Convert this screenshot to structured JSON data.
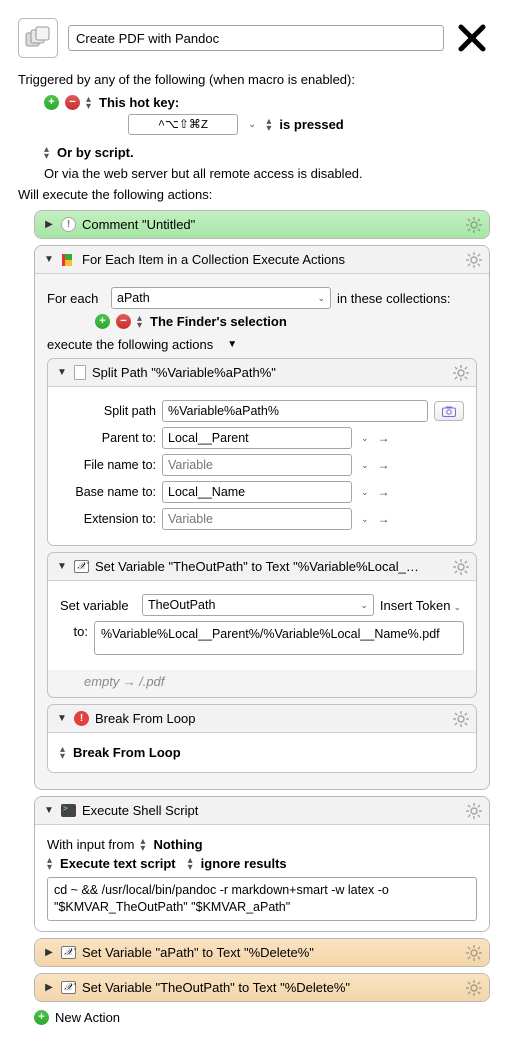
{
  "title": "Create PDF with Pandoc",
  "triggered_label": "Triggered by any of the following (when macro is enabled):",
  "hotkey": {
    "label": "This hot key:",
    "keys": "^⌥⇧⌘Z",
    "condition": "is pressed"
  },
  "script_line": "Or by script.",
  "webserver_line": "Or via the web server but all remote access is disabled.",
  "execute_label": "Will execute the following actions:",
  "comment": {
    "header": "Comment \"Untitled\""
  },
  "foreach": {
    "header": "For Each Item in a Collection Execute Actions",
    "for_each_label": "For each",
    "var_name": "aPath",
    "in_collections": "in these collections:",
    "finder_sel": "The Finder's selection",
    "execute_line": "execute the following actions"
  },
  "splitpath": {
    "header": "Split Path \"%Variable%aPath%\"",
    "label_split": "Split path",
    "val_split": "%Variable%aPath%",
    "label_parent": "Parent to:",
    "val_parent": "Local__Parent",
    "label_filename": "File name to:",
    "ph_variable": "Variable",
    "label_basename": "Base name to:",
    "val_basename": "Local__Name",
    "label_ext": "Extension to:"
  },
  "setvar1": {
    "header": "Set Variable \"TheOutPath\" to Text \"%Variable%Local_…",
    "label_set": "Set variable",
    "val_var": "TheOutPath",
    "insert_token": "Insert Token",
    "label_to": "to:",
    "val_to": "%Variable%Local__Parent%/%Variable%Local__Name%.pdf",
    "empty_line_a": "empty",
    "empty_line_b": "/.pdf"
  },
  "break": {
    "header": "Break From Loop",
    "body": "Break From Loop"
  },
  "shell": {
    "header": "Execute Shell Script",
    "input_label": "With input from",
    "input_val": "Nothing",
    "exec_label": "Execute text script",
    "ignore_label": "ignore results",
    "script": "cd ~ && /usr/local/bin/pandoc -r markdown+smart -w latex -o \"$KMVAR_TheOutPath\" \"$KMVAR_aPath\""
  },
  "setvar2": {
    "header": "Set Variable \"aPath\" to Text \"%Delete%\""
  },
  "setvar3": {
    "header": "Set Variable \"TheOutPath\" to Text \"%Delete%\""
  },
  "new_action": "New Action"
}
